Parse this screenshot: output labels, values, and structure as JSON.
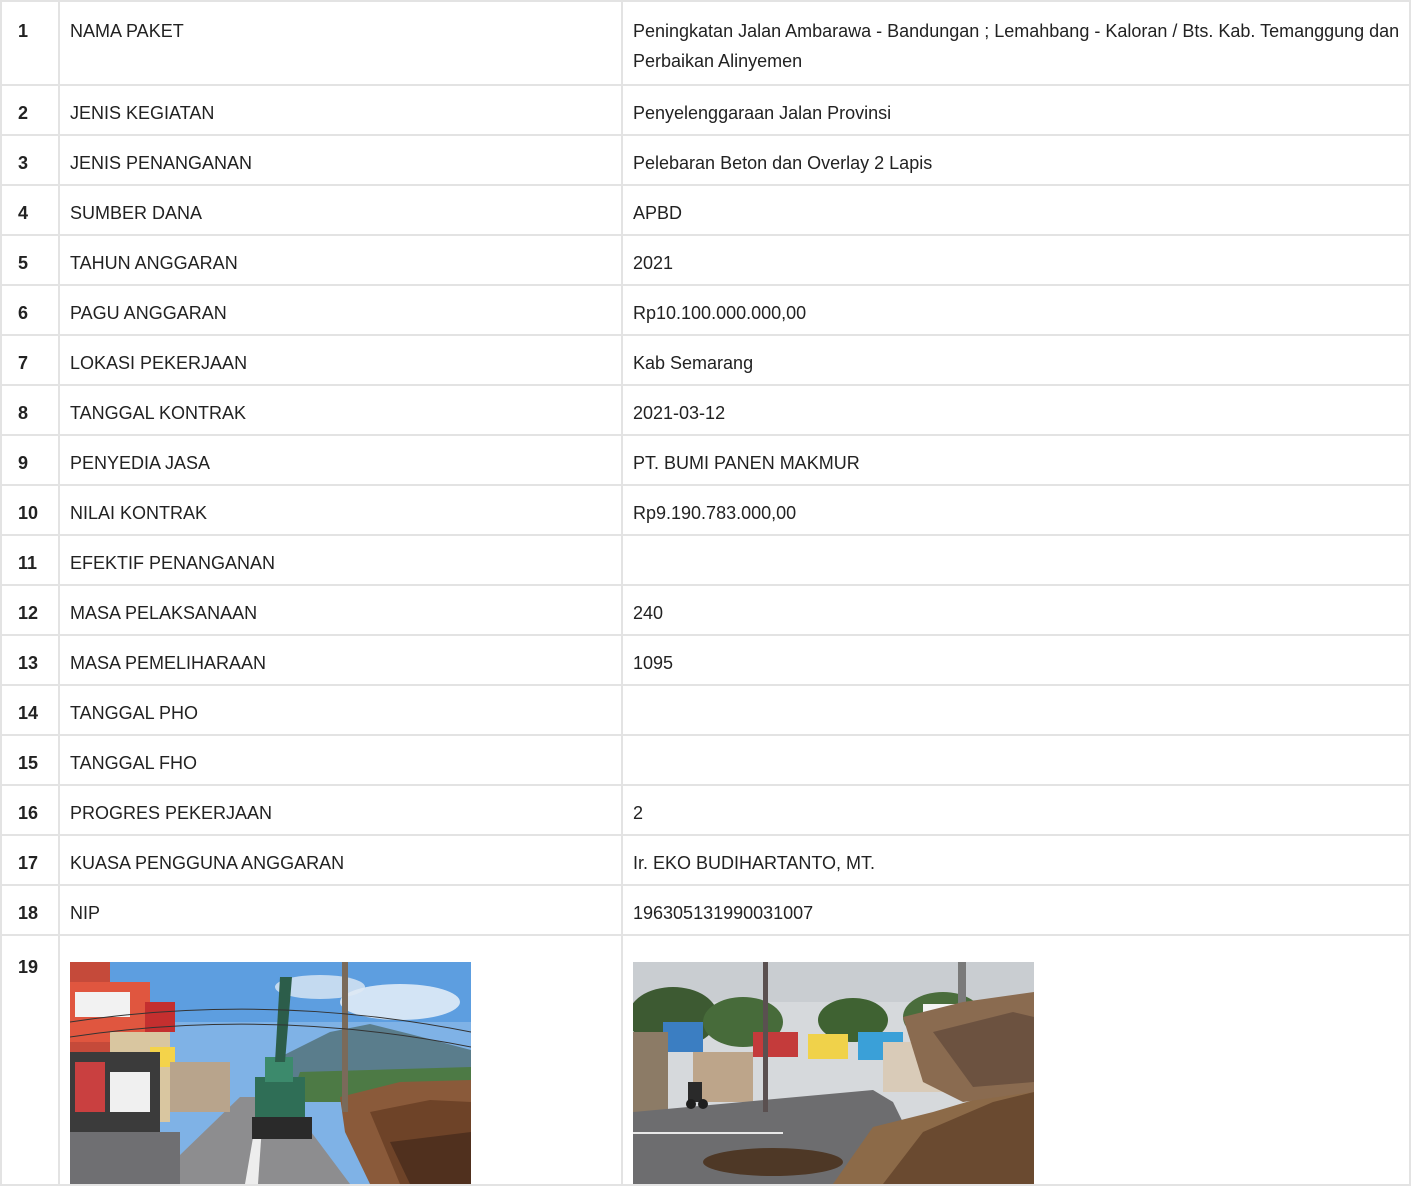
{
  "rows": [
    {
      "no": "1",
      "label": "NAMA PAKET",
      "value": "Peningkatan Jalan Ambarawa - Bandungan ; Lemahbang - Kaloran / Bts. Kab. Temanggung dan Perbaikan Alinyemen"
    },
    {
      "no": "2",
      "label": "JENIS KEGIATAN",
      "value": "Penyelenggaraan Jalan Provinsi"
    },
    {
      "no": "3",
      "label": "JENIS PENANGANAN",
      "value": "Pelebaran Beton dan Overlay 2 Lapis"
    },
    {
      "no": "4",
      "label": "SUMBER DANA",
      "value": "APBD"
    },
    {
      "no": "5",
      "label": "TAHUN ANGGARAN",
      "value": "2021"
    },
    {
      "no": "6",
      "label": "PAGU ANGGARAN",
      "value": "Rp10.100.000.000,00"
    },
    {
      "no": "7",
      "label": "LOKASI PEKERJAAN",
      "value": "Kab Semarang"
    },
    {
      "no": "8",
      "label": "TANGGAL KONTRAK",
      "value": "2021-03-12"
    },
    {
      "no": "9",
      "label": "PENYEDIA JASA",
      "value": "PT. BUMI PANEN MAKMUR"
    },
    {
      "no": "10",
      "label": "NILAI KONTRAK",
      "value": "Rp9.190.783.000,00"
    },
    {
      "no": "11",
      "label": "EFEKTIF PENANGANAN",
      "value": ""
    },
    {
      "no": "12",
      "label": "MASA PELAKSANAAN",
      "value": "240"
    },
    {
      "no": "13",
      "label": "MASA PEMELIHARAAN",
      "value": "1095"
    },
    {
      "no": "14",
      "label": "TANGGAL PHO",
      "value": ""
    },
    {
      "no": "15",
      "label": "TANGGAL FHO",
      "value": ""
    },
    {
      "no": "16",
      "label": "PROGRES PEKERJAAN",
      "value": "2"
    },
    {
      "no": "17",
      "label": "KUASA PENGGUNA ANGGARAN",
      "value": "Ir. EKO BUDIHARTANTO, MT."
    },
    {
      "no": "18",
      "label": "NIP",
      "value": "196305131990031007"
    }
  ],
  "photo_row": {
    "no": "19"
  },
  "colors": {
    "border": "#e3e3e3",
    "text": "#222222"
  }
}
